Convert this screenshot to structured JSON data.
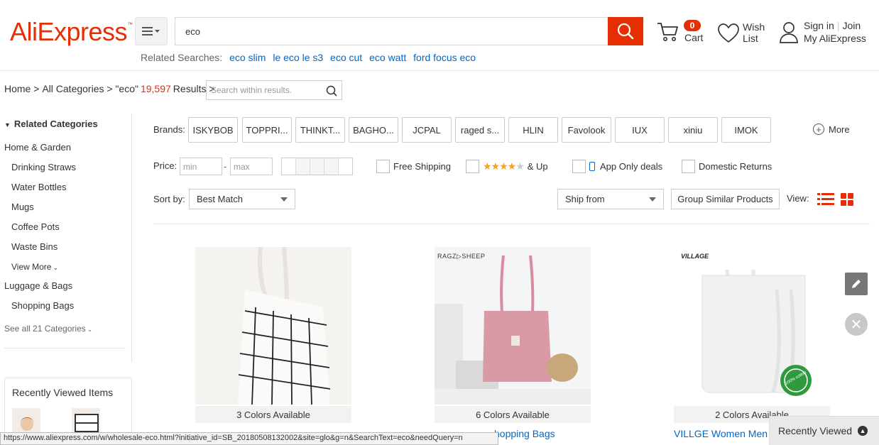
{
  "header": {
    "logo_text": "AliExpress",
    "logo_tm": "™",
    "search_value": "eco",
    "related_label": "Related Searches:",
    "related": [
      {
        "pre": "eco ",
        "bold": "slim"
      },
      {
        "pre": "le eco ",
        "bold": "le s3"
      },
      {
        "pre": "eco ",
        "bold": "cut"
      },
      {
        "pre": "eco ",
        "bold": "watt"
      },
      {
        "pre": "ford focus ",
        "bold": "eco"
      }
    ],
    "cart_count": "0",
    "cart_label": "Cart",
    "wish_line1": "Wish",
    "wish_line2": "List",
    "signin": "Sign in",
    "join": "Join",
    "my_account": "My AliExpress"
  },
  "breadcrumb": {
    "home": "Home",
    "all_categories": "All Categories",
    "query": "\"eco\"",
    "count": "19,597",
    "results": "Results",
    "within_placeholder": "Search within results."
  },
  "sidebar": {
    "title": "Related Categories",
    "home_garden": "Home & Garden",
    "items_a": [
      "Drinking Straws",
      "Water Bottles",
      "Mugs",
      "Coffee Pots",
      "Waste Bins"
    ],
    "view_more": "View More",
    "luggage": "Luggage & Bags",
    "shopping_bags": "Shopping Bags",
    "see_all": "See all 21 Categories",
    "recent_title": "Recently Viewed Items"
  },
  "filters": {
    "brands_label": "Brands:",
    "brands": [
      "ISKYBOB",
      "TOPPRI...",
      "THINKT...",
      "BAGHO...",
      "JCPAL",
      "raged s...",
      "HLIN",
      "Favolook",
      "IUX",
      "xiniu",
      "IMOK"
    ],
    "more": "More",
    "price_label": "Price:",
    "min_placeholder": "min",
    "max_placeholder": "max",
    "free_shipping": "Free Shipping",
    "and_up": "& Up",
    "app_only": "App Only deals",
    "domestic_returns": "Domestic Returns",
    "sort_label": "Sort by:",
    "sort_value": "Best Match",
    "ship_from": "Ship from",
    "group_similar": "Group Similar Products",
    "view_label": "View:"
  },
  "products": [
    {
      "colors": "3 Colors Available",
      "title": ""
    },
    {
      "colors": "6 Colors Available",
      "title": "hopping Bags",
      "brand_mark": "RAGZ▷SHEEP"
    },
    {
      "colors": "2 Colors Available",
      "title": "VILLGE Women Men",
      "brand_mark": "VILLAGE",
      "badge": "100% cotton"
    }
  ],
  "recently_viewed_bar": "Recently Viewed",
  "status_url": "https://www.aliexpress.com/w/wholesale-eco.html?initiative_id=SB_20180508132002&site=glo&g=n&SearchText=eco&needQuery=n",
  "colors": {
    "accent": "#e62e04",
    "link": "#0066cc",
    "star": "#f7a21b"
  }
}
